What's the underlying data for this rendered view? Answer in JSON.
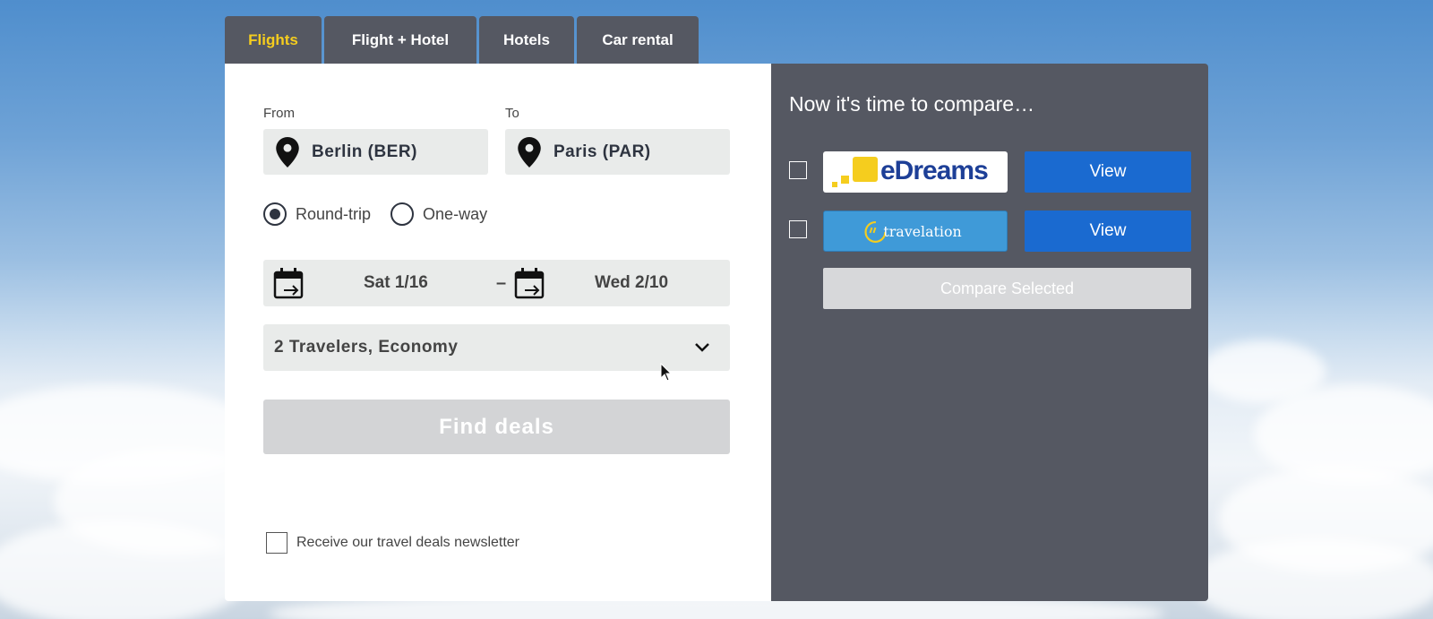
{
  "tabs": [
    {
      "label": "Flights",
      "active": true
    },
    {
      "label": "Flight + Hotel",
      "active": false
    },
    {
      "label": "Hotels",
      "active": false
    },
    {
      "label": "Car rental",
      "active": false
    }
  ],
  "form": {
    "from_label": "From",
    "from_value": "Berlin (BER)",
    "to_label": "To",
    "to_value": "Paris (PAR)",
    "trip_type": {
      "round_trip_label": "Round-trip",
      "one_way_label": "One-way",
      "selected": "Round-trip"
    },
    "depart_date": "Sat 1/16",
    "date_separator": "–",
    "return_date": "Wed 2/10",
    "travelers": "2 Travelers, Economy",
    "find_deals_label": "Find deals",
    "newsletter_label": "Receive our travel deals newsletter",
    "newsletter_checked": false
  },
  "compare": {
    "title": "Now it's time to compare…",
    "providers": [
      {
        "name": "eDreams",
        "checked": false,
        "view_label": "View"
      },
      {
        "name": "travelation",
        "checked": false,
        "view_label": "View"
      }
    ],
    "compare_selected_label": "Compare Selected"
  },
  "colors": {
    "tab_bg": "#555862",
    "active_tab_text": "#f5cd1e",
    "field_bg": "#e9ebea",
    "view_button": "#1a6ad0",
    "disabled_button": "#d3d4d6"
  },
  "icons": [
    "map-pin-icon",
    "calendar-icon",
    "chevron-down-icon",
    "edreams-logo",
    "travelation-logo"
  ]
}
